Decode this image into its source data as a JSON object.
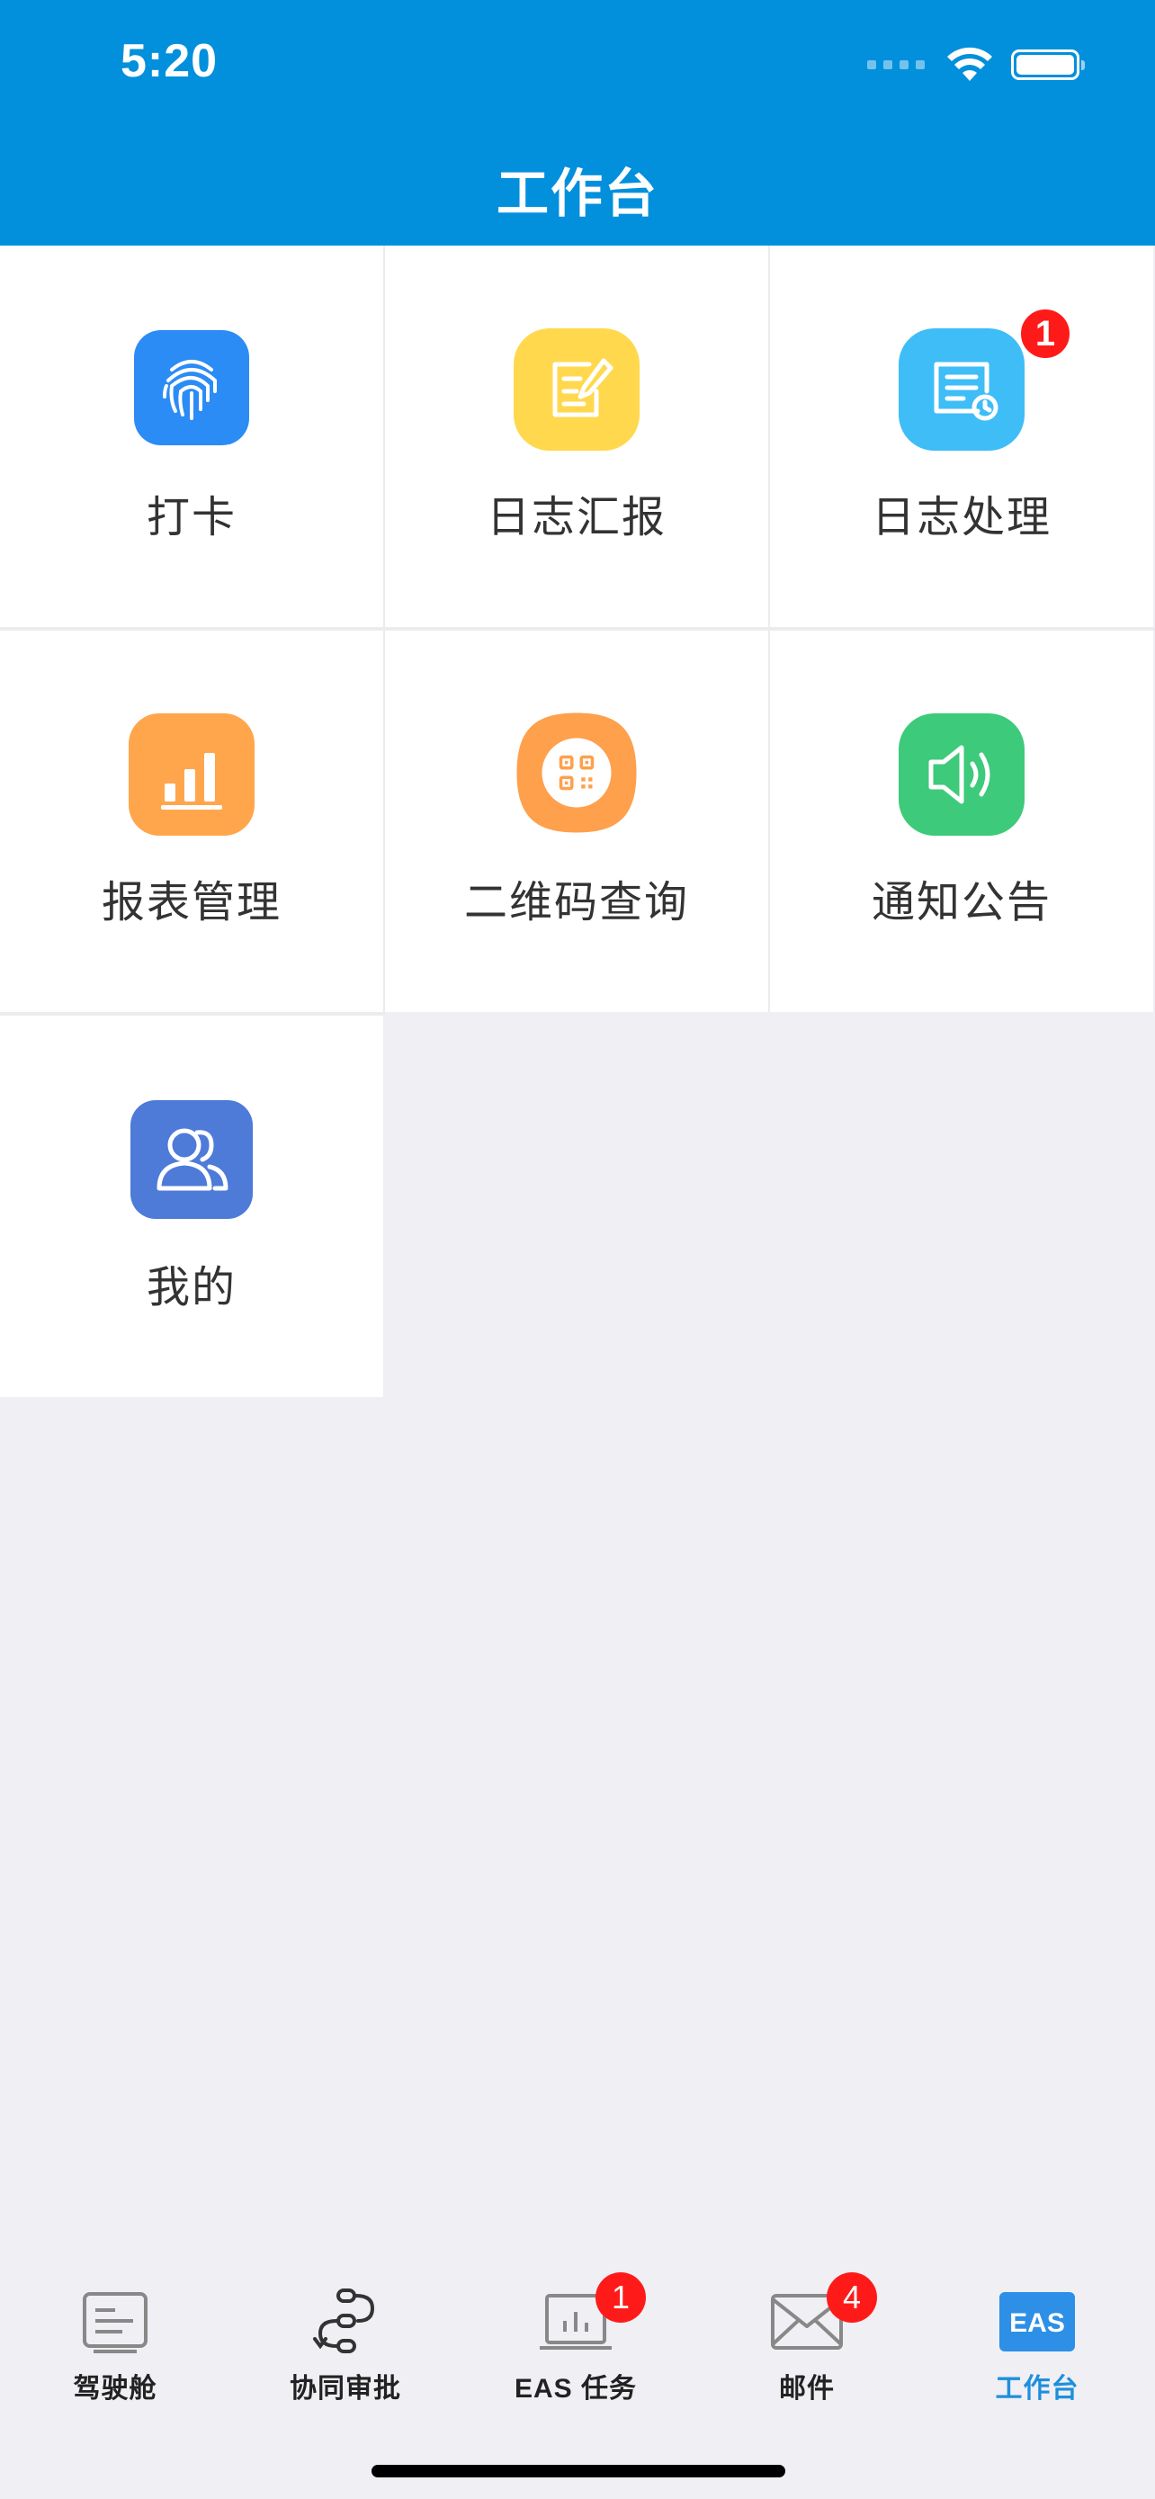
{
  "status_bar": {
    "time": "5:20"
  },
  "header": {
    "title": "工作台"
  },
  "grid": [
    {
      "label": "打卡",
      "icon": "fingerprint-icon",
      "color": "#2b8cf5",
      "badge": ""
    },
    {
      "label": "日志汇报",
      "icon": "edit-note-icon",
      "color": "#ffd84d",
      "badge": ""
    },
    {
      "label": "日志处理",
      "icon": "log-process-icon",
      "color": "#3ebdf7",
      "badge": "1"
    },
    {
      "label": "报表管理",
      "icon": "bar-chart-icon",
      "color": "#ffa64d",
      "badge": ""
    },
    {
      "label": "二维码查询",
      "icon": "qrcode-icon",
      "color": "#ffa04d",
      "badge": ""
    },
    {
      "label": "通知公告",
      "icon": "speaker-icon",
      "color": "#3dca7a",
      "badge": ""
    },
    {
      "label": "我的",
      "icon": "user-group-icon",
      "color": "#4e7ad8",
      "badge": ""
    }
  ],
  "tabbar": [
    {
      "label": "驾驶舱",
      "icon": "cockpit-icon",
      "badge": ""
    },
    {
      "label": "协同审批",
      "icon": "approval-flow-icon",
      "badge": ""
    },
    {
      "label": "EAS 任务",
      "icon": "task-laptop-icon",
      "badge": "1"
    },
    {
      "label": "邮件",
      "icon": "mail-icon",
      "badge": "4"
    },
    {
      "label": "工作台",
      "icon": "eas-icon",
      "badge": "",
      "active": true
    }
  ],
  "colors": {
    "header": "#0290dc",
    "active_tab": "#1f8fdc",
    "badge": "#ff1a1a"
  }
}
